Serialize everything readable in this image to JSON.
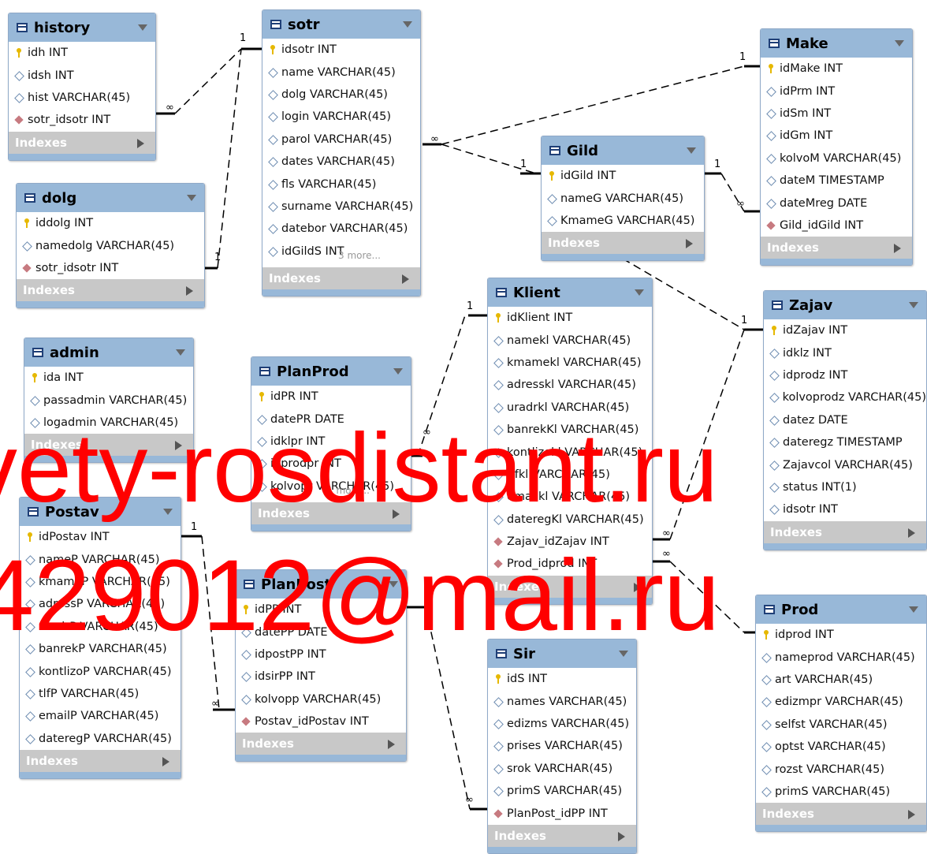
{
  "tables": {
    "history": {
      "title": "history",
      "fields": [
        {
          "t": "pk",
          "text": "idh INT"
        },
        {
          "t": "col",
          "text": "idsh INT"
        },
        {
          "t": "col",
          "text": "hist VARCHAR(45)"
        },
        {
          "t": "fk",
          "text": "sotr_idsotr INT"
        }
      ],
      "indexes": "Indexes"
    },
    "dolg": {
      "title": "dolg",
      "fields": [
        {
          "t": "pk",
          "text": "iddolg INT"
        },
        {
          "t": "col",
          "text": "namedolg VARCHAR(45)"
        },
        {
          "t": "fk",
          "text": "sotr_idsotr INT"
        }
      ],
      "indexes": "Indexes"
    },
    "admin": {
      "title": "admin",
      "fields": [
        {
          "t": "pk",
          "text": "ida INT"
        },
        {
          "t": "col",
          "text": "passadmin VARCHAR(45)"
        },
        {
          "t": "col",
          "text": "logadmin VARCHAR(45)"
        }
      ],
      "indexes": "Indexes"
    },
    "postav": {
      "title": "Postav",
      "fields": [
        {
          "t": "pk",
          "text": "idPostav INT"
        },
        {
          "t": "col",
          "text": "nameP VARCHAR(45)"
        },
        {
          "t": "col",
          "text": "kmameP VARCHAR(45)"
        },
        {
          "t": "col",
          "text": "adressP VARCHAR(45)"
        },
        {
          "t": "col",
          "text": "uradrP VARCHAR(45)"
        },
        {
          "t": "col",
          "text": "banrekP VARCHAR(45)"
        },
        {
          "t": "col",
          "text": "kontlizoP VARCHAR(45)"
        },
        {
          "t": "col",
          "text": "tlfP VARCHAR(45)"
        },
        {
          "t": "col",
          "text": "emailP VARCHAR(45)"
        },
        {
          "t": "col",
          "text": "dateregP VARCHAR(45)"
        }
      ],
      "indexes": "Indexes"
    },
    "sotr": {
      "title": "sotr",
      "fields": [
        {
          "t": "pk",
          "text": "idsotr INT"
        },
        {
          "t": "col",
          "text": "name VARCHAR(45)"
        },
        {
          "t": "col",
          "text": "dolg VARCHAR(45)"
        },
        {
          "t": "col",
          "text": "login VARCHAR(45)"
        },
        {
          "t": "col",
          "text": "parol VARCHAR(45)"
        },
        {
          "t": "col",
          "text": "dates VARCHAR(45)"
        },
        {
          "t": "col",
          "text": "fls VARCHAR(45)"
        },
        {
          "t": "col",
          "text": "surname VARCHAR(45)"
        },
        {
          "t": "col",
          "text": "datebor VARCHAR(45)"
        },
        {
          "t": "col",
          "text": "idGildS INT"
        }
      ],
      "more": "3 more...",
      "indexes": "Indexes"
    },
    "planprod": {
      "title": "PlanProd",
      "fields": [
        {
          "t": "pk",
          "text": "idPR INT"
        },
        {
          "t": "col",
          "text": "datePR DATE"
        },
        {
          "t": "col",
          "text": "idklpr INT"
        },
        {
          "t": "col",
          "text": "idprodpr INT"
        },
        {
          "t": "col",
          "text": "kolvopr VARCHAR(45)"
        }
      ],
      "more": "1 more...",
      "indexes": "Indexes"
    },
    "planpost": {
      "title": "PlanPost",
      "fields": [
        {
          "t": "pk",
          "text": "idPP INT"
        },
        {
          "t": "col",
          "text": "datePP DATE"
        },
        {
          "t": "col",
          "text": "idpostPP INT"
        },
        {
          "t": "col",
          "text": "idsirPP INT"
        },
        {
          "t": "col",
          "text": "kolvopp VARCHAR(45)"
        },
        {
          "t": "fk",
          "text": "Postav_idPostav INT"
        }
      ],
      "indexes": "Indexes"
    },
    "gild": {
      "title": "Gild",
      "fields": [
        {
          "t": "pk",
          "text": "idGild INT"
        },
        {
          "t": "col",
          "text": "nameG VARCHAR(45)"
        },
        {
          "t": "col",
          "text": "KmameG VARCHAR(45)"
        }
      ],
      "indexes": "Indexes"
    },
    "klient": {
      "title": "Klient",
      "fields": [
        {
          "t": "pk",
          "text": "idKlient INT"
        },
        {
          "t": "col",
          "text": "namekl VARCHAR(45)"
        },
        {
          "t": "col",
          "text": "kmamekl VARCHAR(45)"
        },
        {
          "t": "col",
          "text": "adresskl VARCHAR(45)"
        },
        {
          "t": "col",
          "text": "uradrkl VARCHAR(45)"
        },
        {
          "t": "col",
          "text": "banrekKl VARCHAR(45)"
        },
        {
          "t": "col",
          "text": "kontlizokl VARCHAR(45)"
        },
        {
          "t": "col",
          "text": "tlfkl VARCHAR(45)"
        },
        {
          "t": "col",
          "text": "emailkl VARCHAR(45)"
        },
        {
          "t": "col",
          "text": "dateregKl VARCHAR(45)"
        },
        {
          "t": "fk",
          "text": "Zajav_idZajav INT"
        },
        {
          "t": "fk",
          "text": "Prod_idprod INT"
        }
      ],
      "indexes": "Indexes"
    },
    "sir": {
      "title": "Sir",
      "fields": [
        {
          "t": "pk",
          "text": "idS INT"
        },
        {
          "t": "col",
          "text": "names VARCHAR(45)"
        },
        {
          "t": "col",
          "text": "edizms VARCHAR(45)"
        },
        {
          "t": "col",
          "text": "prises VARCHAR(45)"
        },
        {
          "t": "col",
          "text": "srok VARCHAR(45)"
        },
        {
          "t": "col",
          "text": "primS VARCHAR(45)"
        },
        {
          "t": "fk",
          "text": "PlanPost_idPP INT"
        }
      ],
      "indexes": "Indexes"
    },
    "make": {
      "title": "Make",
      "fields": [
        {
          "t": "pk",
          "text": "idMake INT"
        },
        {
          "t": "col",
          "text": "idPrm INT"
        },
        {
          "t": "col",
          "text": "idSm INT"
        },
        {
          "t": "col",
          "text": "idGm INT"
        },
        {
          "t": "col",
          "text": "kolvoM VARCHAR(45)"
        },
        {
          "t": "col",
          "text": "dateM TIMESTAMP"
        },
        {
          "t": "col",
          "text": "dateMreg DATE"
        },
        {
          "t": "fk",
          "text": "Gild_idGild INT"
        }
      ],
      "indexes": "Indexes"
    },
    "zajav": {
      "title": "Zajav",
      "fields": [
        {
          "t": "pk",
          "text": "idZajav INT"
        },
        {
          "t": "col",
          "text": "idklz INT"
        },
        {
          "t": "col",
          "text": "idprodz INT"
        },
        {
          "t": "col",
          "text": "kolvoprodz VARCHAR(45)"
        },
        {
          "t": "col",
          "text": "datez DATE"
        },
        {
          "t": "col",
          "text": "dateregz TIMESTAMP"
        },
        {
          "t": "col",
          "text": "Zajavcol VARCHAR(45)"
        },
        {
          "t": "col",
          "text": "status INT(1)"
        },
        {
          "t": "col",
          "text": "idsotr INT"
        }
      ],
      "indexes": "Indexes"
    },
    "prod": {
      "title": "Prod",
      "fields": [
        {
          "t": "pk",
          "text": "idprod INT"
        },
        {
          "t": "col",
          "text": "nameprod VARCHAR(45)"
        },
        {
          "t": "col",
          "text": "art VARCHAR(45)"
        },
        {
          "t": "col",
          "text": "edizmpr VARCHAR(45)"
        },
        {
          "t": "col",
          "text": "selfst VARCHAR(45)"
        },
        {
          "t": "col",
          "text": "optst VARCHAR(45)"
        },
        {
          "t": "col",
          "text": "rozst VARCHAR(45)"
        },
        {
          "t": "col",
          "text": "primS VARCHAR(45)"
        }
      ],
      "indexes": "Indexes"
    }
  },
  "cardinality": {
    "one": "1",
    "many": "∞"
  },
  "watermark": {
    "line1": "vety-rosdistant.ru",
    "line2": "429012@mail.ru"
  }
}
